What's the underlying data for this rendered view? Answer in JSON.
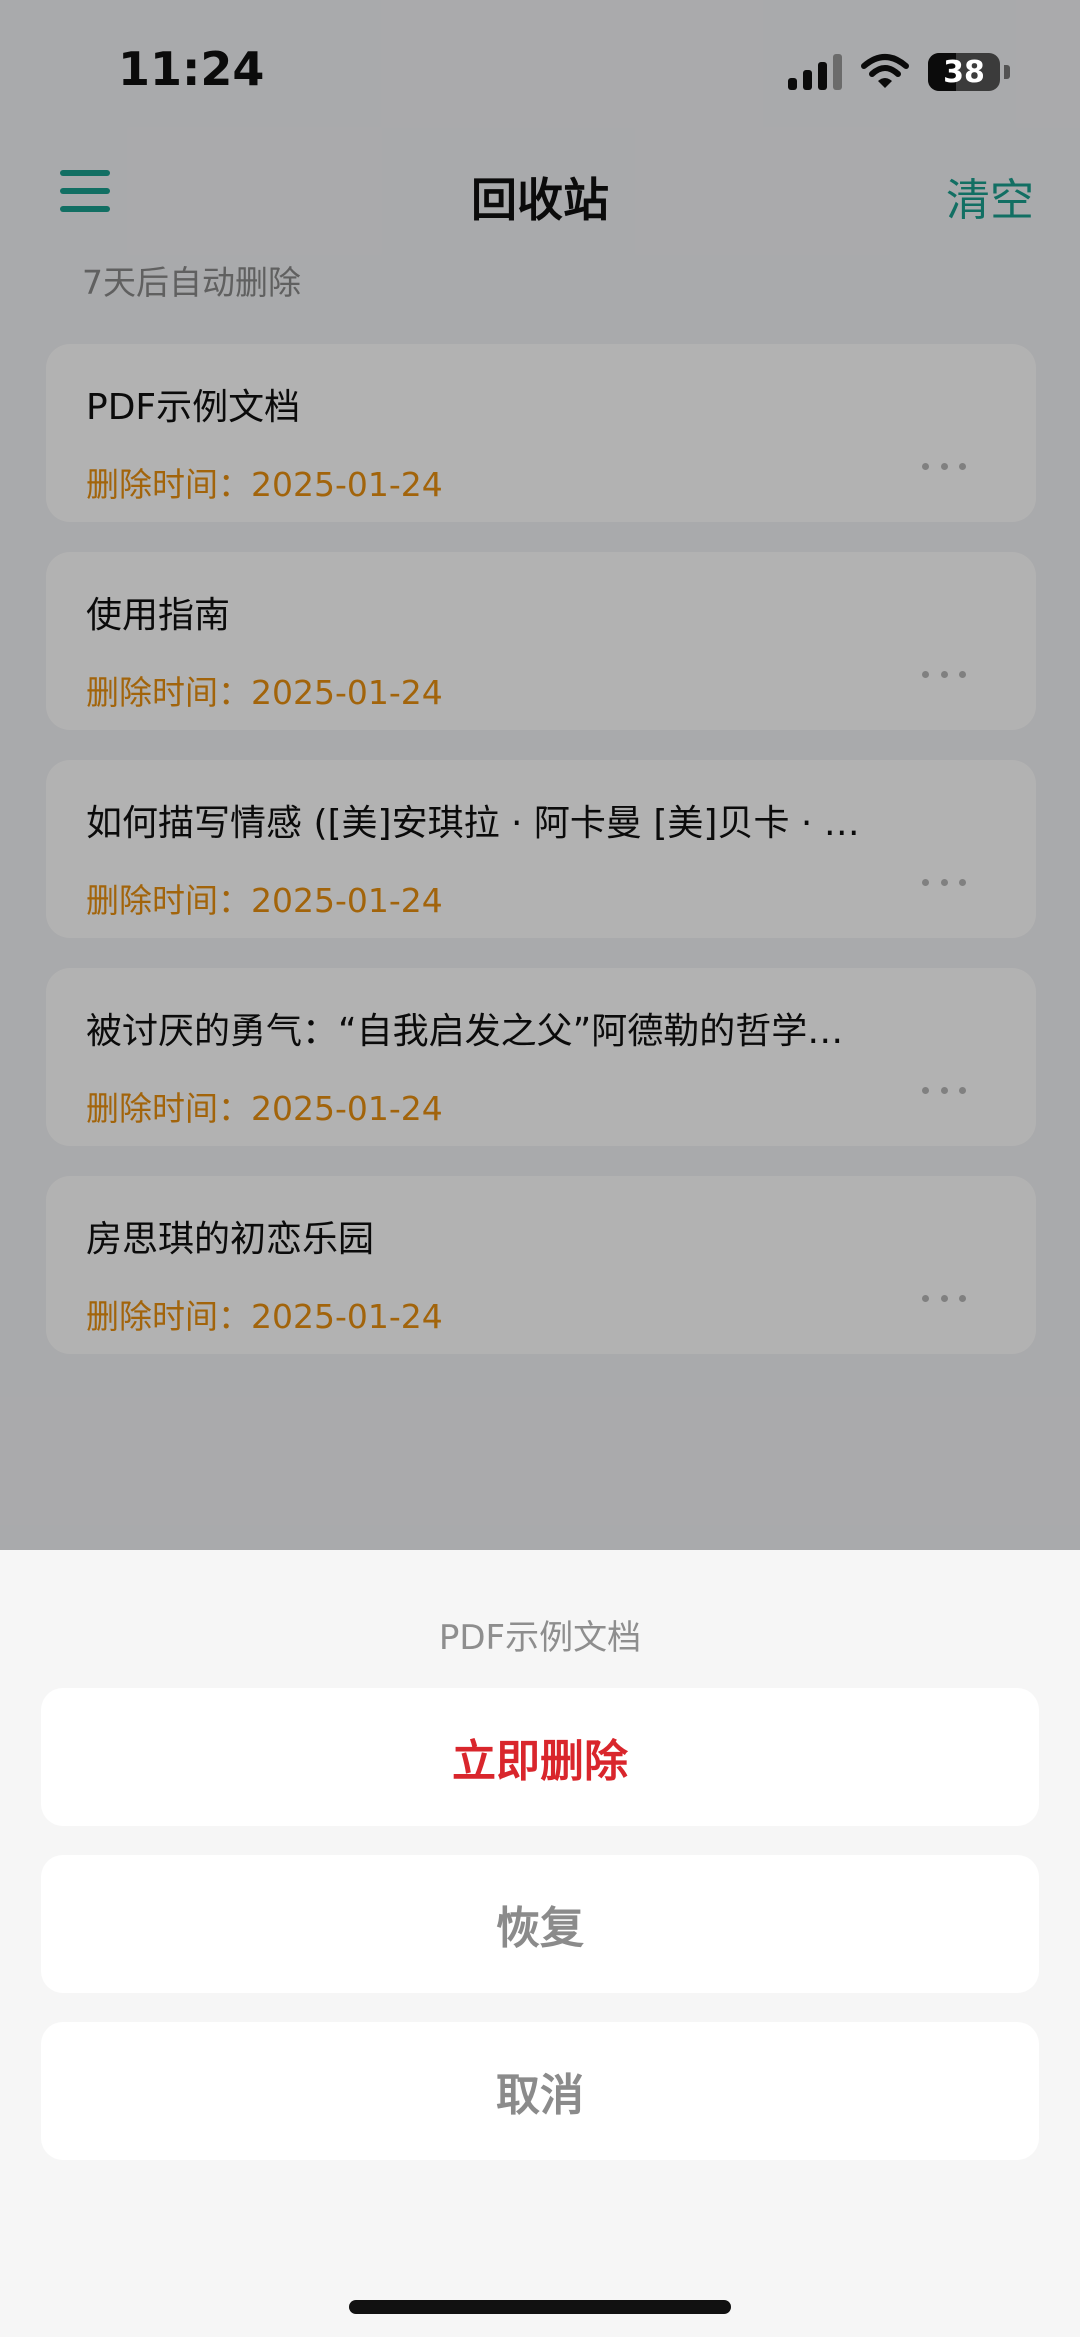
{
  "status": {
    "time": "11:24",
    "battery": "38"
  },
  "nav": {
    "title": "回收站",
    "clear_label": "清空"
  },
  "hint": "7天后自动删除",
  "docs": [
    {
      "title": "PDF示例文档",
      "date": "删除时间：2025-01-24"
    },
    {
      "title": "使用指南",
      "date": "删除时间：2025-01-24"
    },
    {
      "title": "如何描写情感 ([美]安琪拉 · 阿卡曼 [美]贝卡 · …",
      "date": "删除时间：2025-01-24"
    },
    {
      "title": "被讨厌的勇气：“自我启发之父”阿德勒的哲学…",
      "date": "删除时间：2025-01-24"
    },
    {
      "title": "房思琪的初恋乐园",
      "date": "删除时间：2025-01-24"
    }
  ],
  "sheet": {
    "title": "PDF示例文档",
    "delete_label": "立即删除",
    "restore_label": "恢复",
    "cancel_label": "取消"
  },
  "colors": {
    "accent": "#1a9f8e",
    "date": "#e89010",
    "danger": "#d9262c"
  },
  "icons": {
    "menu": "menu-icon",
    "more": "more-icon",
    "signal": "signal-icon",
    "wifi": "wifi-icon",
    "battery": "battery-icon"
  }
}
